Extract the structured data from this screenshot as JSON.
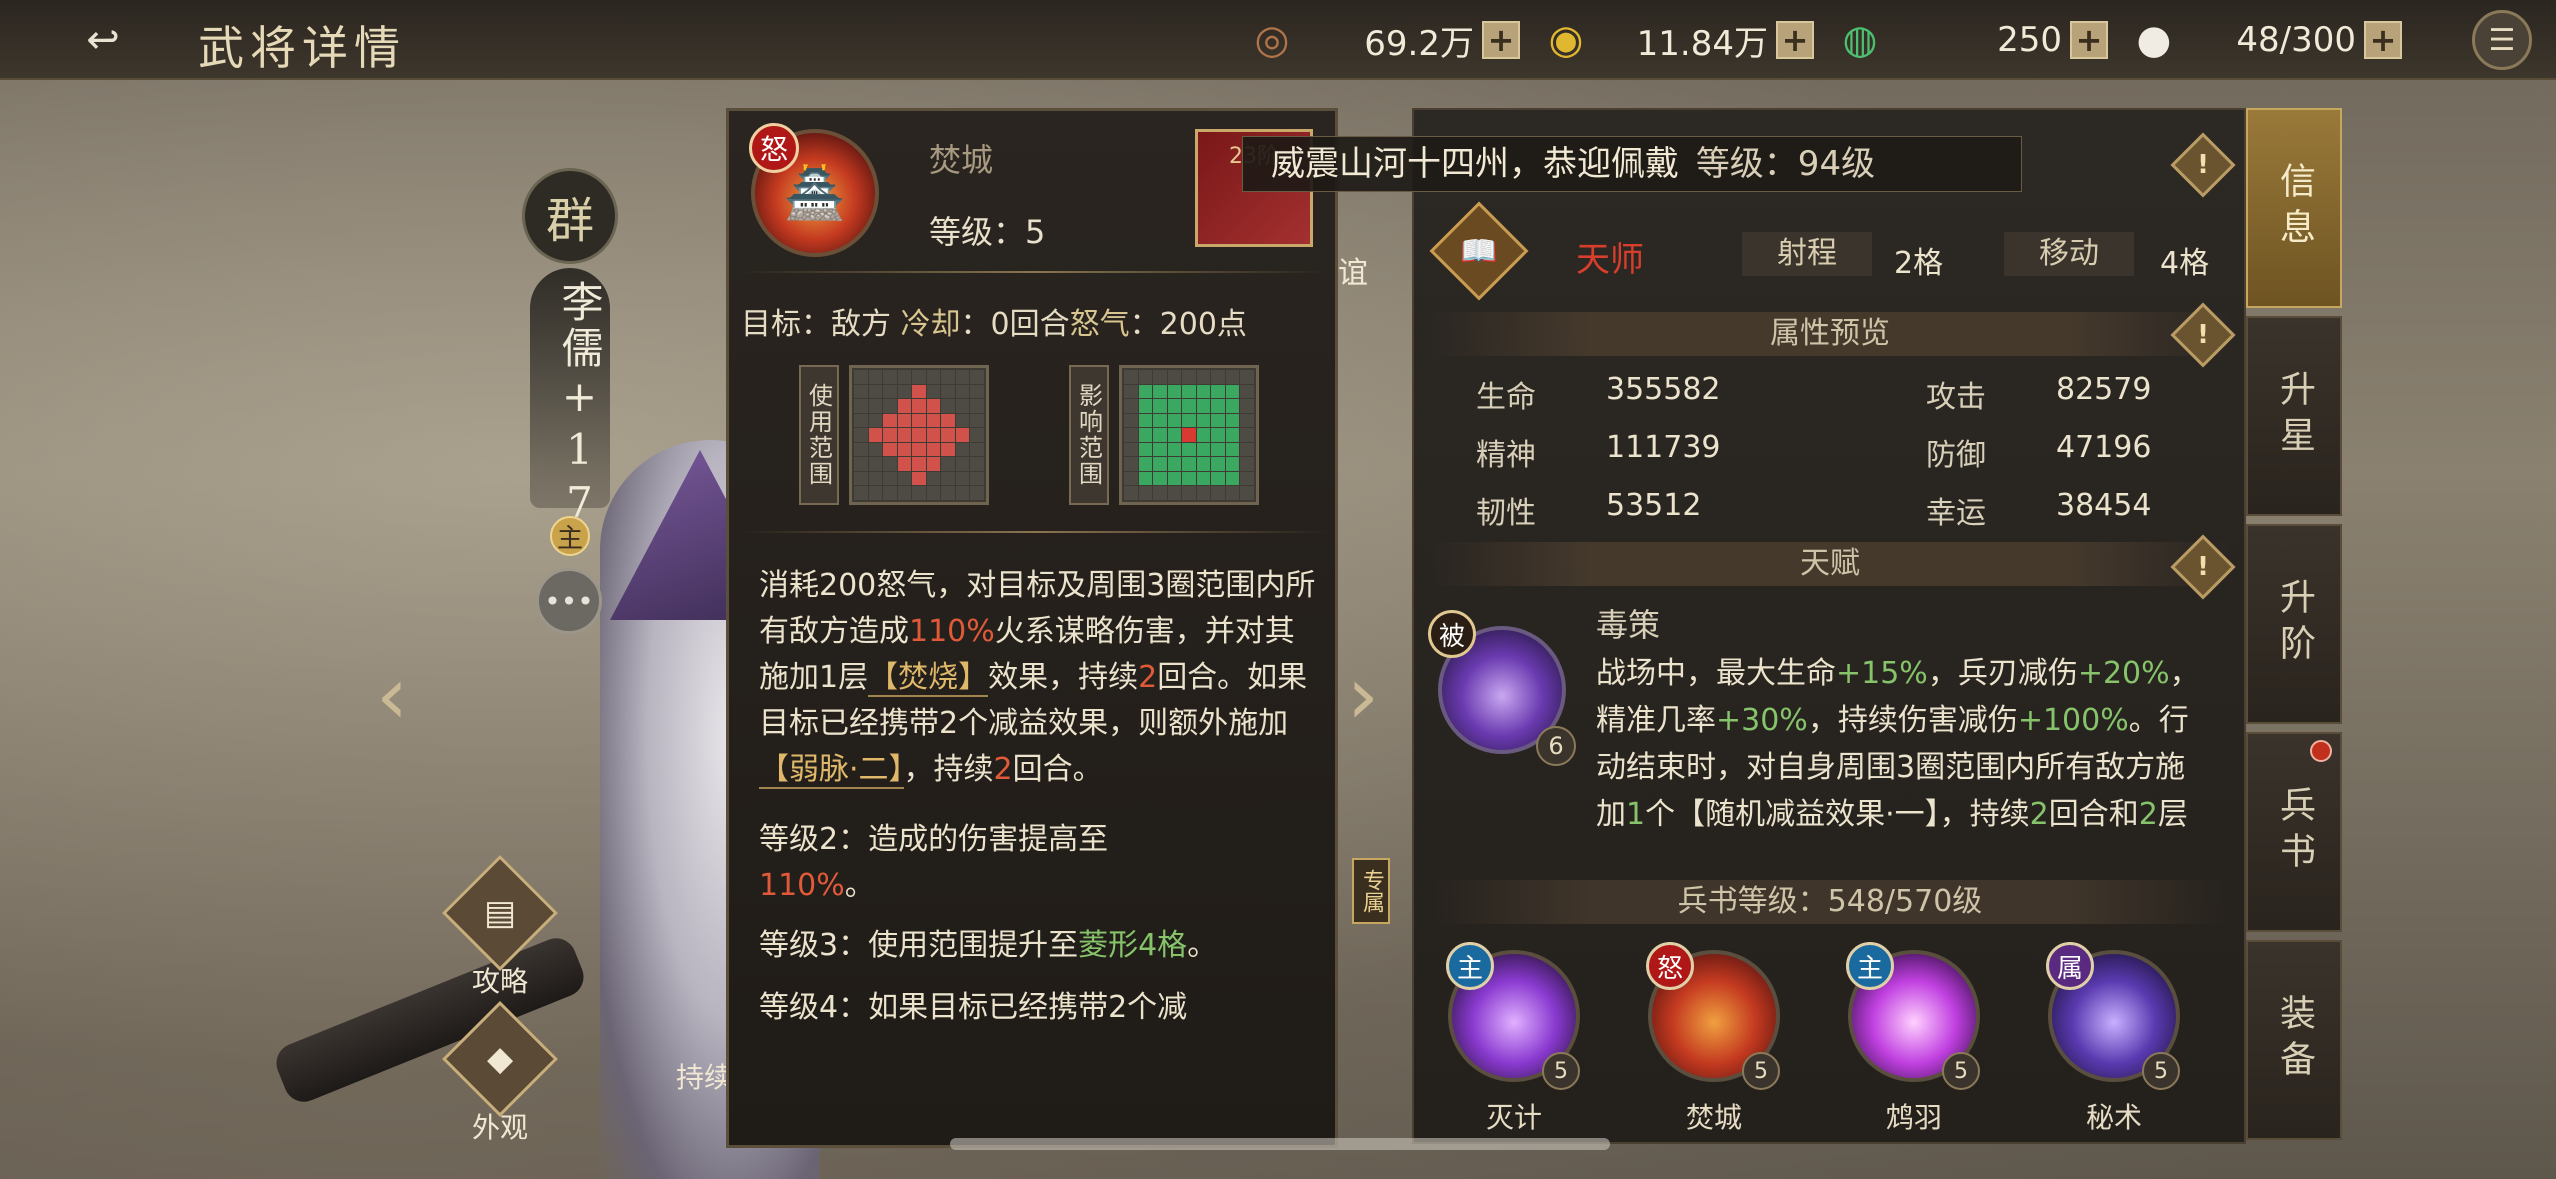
{
  "topbar": {
    "title": "武将详情",
    "resources": [
      {
        "icon": "copper-coins-icon",
        "value": "69.2万"
      },
      {
        "icon": "gold-coin-icon",
        "value": "11.84万"
      },
      {
        "icon": "jade-icon",
        "value": "250"
      },
      {
        "icon": "steamed-bun-icon",
        "value": "48/300"
      }
    ],
    "plus": "+"
  },
  "hero": {
    "faction": "群",
    "name": "李儒",
    "plus": "+",
    "upgrade": "17",
    "main_badge": "主",
    "actions": [
      {
        "label": "攻略"
      },
      {
        "label": "外观"
      }
    ],
    "partial_label": "持续",
    "side_label_1": "专属",
    "side_label_2": "谊"
  },
  "skill": {
    "rage_tag": "怒",
    "name": "焚城",
    "level": "等级：5",
    "scroll_label": "23阶",
    "target_prefix": "目标：敌方",
    "cooldown_label": "冷却",
    "cooldown_value": "：0回合",
    "rage_label": "怒气",
    "rage_value": "：200点",
    "use_range_label": "使用范围",
    "effect_range_label": "影响范围",
    "desc_parts": {
      "a": "消耗200怒气，对目标及周围3圈范围内所有敌方造成",
      "b": "110%",
      "c": "火系谋略伤害，并对其施加1层",
      "d": "【焚烧】",
      "e": "效果，持续",
      "f": "2",
      "g": "回合。如果目标已经携带2个减益效果，则额外施加",
      "h": "【弱脉·二】",
      "i": "，持续",
      "j": "2",
      "k": "回合。"
    },
    "lv2_prefix": "等级2：造成的伤害提高至",
    "lv2_value": "110%",
    "lv2_suffix": "。",
    "lv3_prefix": "等级3：使用范围提升至",
    "lv3_value": "菱形4格",
    "lv3_suffix": "。",
    "lv4_partial": "等级4：如果目标已经携带2个减"
  },
  "info": {
    "tooltip_text": "威震山河十四州，恭迎佩戴",
    "tooltip_level": "等级：94级",
    "class_name": "天师",
    "range_label": "射程",
    "range_value": "2格",
    "move_label": "移动",
    "move_value": "4格",
    "attr_header": "属性预览",
    "attributes": [
      {
        "label": "生命",
        "value": "355582"
      },
      {
        "label": "攻击",
        "value": "82579"
      },
      {
        "label": "精神",
        "value": "111739"
      },
      {
        "label": "防御",
        "value": "47196"
      },
      {
        "label": "韧性",
        "value": "53512"
      },
      {
        "label": "幸运",
        "value": "38454"
      }
    ],
    "talent_header": "天赋",
    "talent": {
      "tag": "被",
      "level": "6",
      "name": "毒策",
      "parts": {
        "a": "战场中，最大生命",
        "b": "+15%",
        "c": "，兵刃减伤",
        "d": "+20%",
        "e": "，精准几率",
        "f": "+30%",
        "g": "，持续伤害减伤",
        "h": "+100%",
        "i": "。行动结束时，对自身周围3圈范围内所有敌方施加",
        "j": "1",
        "k": "个【随机减益效果·一】，持续",
        "l": "2",
        "m": "回合和",
        "n": "2",
        "o": "层"
      }
    },
    "bookset_header": "兵书等级：548/570级",
    "book_skills": [
      {
        "tag": "主",
        "name": "灭计",
        "level": "5"
      },
      {
        "tag": "怒",
        "name": "焚城",
        "level": "5"
      },
      {
        "tag": "主",
        "name": "鸩羽",
        "level": "5"
      },
      {
        "tag": "属",
        "name": "秘术",
        "level": "5"
      }
    ],
    "warn": "!"
  },
  "tabs": [
    {
      "label": "信息",
      "active": true
    },
    {
      "label": "升星"
    },
    {
      "label": "升阶"
    },
    {
      "label": "兵书"
    },
    {
      "label": "装备"
    }
  ],
  "colors": {
    "accent_gold": "#c7a660",
    "class_red": "#d83e2c",
    "buff_green": "#86c36a",
    "damage_red": "#e05a3a"
  }
}
